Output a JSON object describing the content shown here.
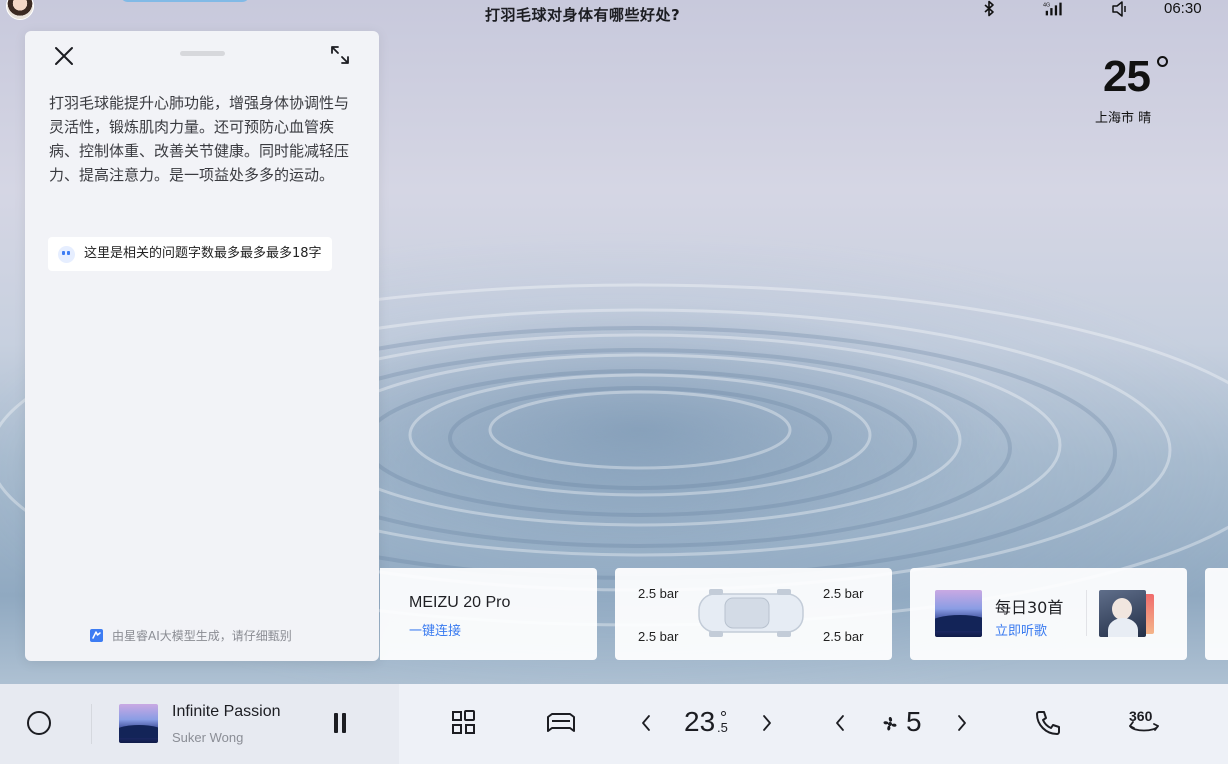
{
  "status_bar": {
    "question": "打羽毛球对身体有哪些好处?",
    "time": "06:30",
    "icons": [
      "bluetooth-icon",
      "signal-icon",
      "volume-icon"
    ]
  },
  "weather": {
    "temperature": "25",
    "location": "上海市 晴"
  },
  "ai_panel": {
    "answer": "打羽毛球能提升心肺功能，增强身体协调性与灵活性，锻炼肌肉力量。还可预防心血管疾病、控制体重、改善关节健康。同时能减轻压力、提高注意力。是一项益处多多的运动。",
    "related_question": "这里是相关的问题字数最多最多最多18字",
    "disclaimer": "由星睿AI大模型生成，请仔细甄别"
  },
  "cards": {
    "phone": {
      "name": "MEIZU 20 Pro",
      "action": "一键连接"
    },
    "tires": {
      "front_left": "2.5 bar",
      "front_right": "2.5 bar",
      "rear_left": "2.5 bar",
      "rear_right": "2.5 bar"
    },
    "music": {
      "title": "每日30首",
      "action": "立即听歌"
    }
  },
  "dock": {
    "now_playing": {
      "title": "Infinite Passion",
      "artist": "Suker Wong"
    },
    "temperature": {
      "integer": "23",
      "decimal": ".5"
    },
    "fan_speed": "5",
    "icons": [
      "home-icon",
      "pause-icon",
      "apps-grid-icon",
      "car-seat-icon",
      "phone-icon",
      "camera-360-icon",
      "fan-icon"
    ]
  },
  "colors": {
    "accent": "#3a7bf0",
    "panel_bg": "#f2f3f7",
    "dock_bg": "#eef1f7",
    "text": "#1c1d22"
  }
}
